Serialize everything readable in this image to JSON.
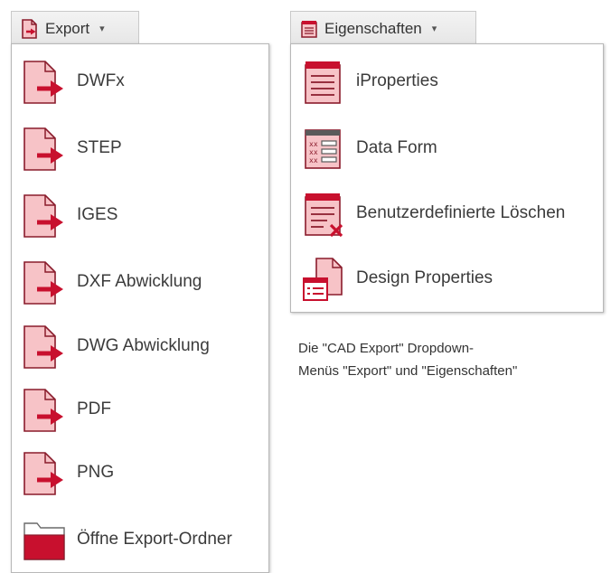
{
  "export_menu": {
    "tab_label": "Export",
    "caret": "▾",
    "tab_icon": "export-file-icon",
    "items": [
      {
        "label": "DWFx",
        "icon": "export-file-icon"
      },
      {
        "label": "STEP",
        "icon": "export-file-icon"
      },
      {
        "label": "IGES",
        "icon": "export-file-icon"
      },
      {
        "label": "DXF Abwicklung",
        "icon": "export-file-icon"
      },
      {
        "label": "DWG Abwicklung",
        "icon": "export-file-icon"
      },
      {
        "label": "PDF",
        "icon": "export-file-icon"
      },
      {
        "label": "PNG",
        "icon": "export-file-icon"
      },
      {
        "label": "Öffne Export-Ordner",
        "icon": "folder-icon"
      }
    ]
  },
  "properties_menu": {
    "tab_label": "Eigenschaften",
    "caret": "▾",
    "tab_icon": "properties-list-icon",
    "items": [
      {
        "label": "iProperties",
        "icon": "properties-list-icon"
      },
      {
        "label": "Data Form",
        "icon": "data-form-icon"
      },
      {
        "label": "Benutzerdefinierte Löschen",
        "icon": "delete-properties-icon"
      },
      {
        "label": "Design Properties",
        "icon": "design-properties-icon"
      }
    ]
  },
  "caption": {
    "line1": "Die \"CAD Export\" Dropdown-",
    "line2": "Menüs \"Export\" und \"Eigenschaften\""
  },
  "colors": {
    "icon_fill": "#f7c3c7",
    "icon_stroke": "#8a1c2c",
    "accent": "#c8102e"
  }
}
